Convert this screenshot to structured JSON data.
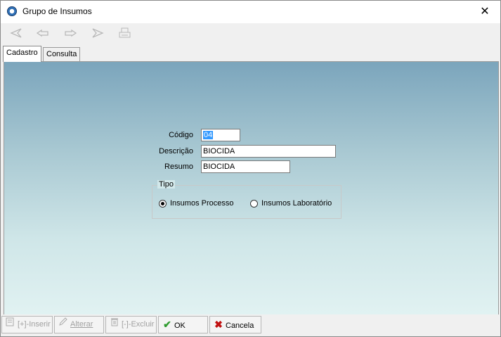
{
  "window": {
    "title": "Grupo de Insumos",
    "close_glyph": "✕"
  },
  "toolbar": {
    "icons": [
      "first-icon",
      "previous-icon",
      "next-icon",
      "last-icon",
      "print-icon"
    ]
  },
  "tabs": [
    {
      "label": "Cadastro",
      "active": true
    },
    {
      "label": "Consulta",
      "active": false
    }
  ],
  "form": {
    "codigo_label": "Código",
    "codigo_value": "04",
    "descricao_label": "Descrição",
    "descricao_value": "BIOCIDA",
    "resumo_label": "Resumo",
    "resumo_value": "BIOCIDA",
    "tipo": {
      "label": "Tipo",
      "options": [
        {
          "label": "Insumos Processo",
          "selected": true
        },
        {
          "label": "Insumos Laboratório",
          "selected": false
        }
      ]
    }
  },
  "buttons": {
    "inserir": "[+]-Inserir",
    "alterar": "Alterar",
    "excluir": "[-]-Excluir",
    "ok": "OK",
    "cancela": "Cancela"
  },
  "colors": {
    "gradient_top": "#7ba5bc",
    "gradient_bottom": "#e1f2f2",
    "ok_green": "#2e9b2e",
    "cancel_red": "#c01010",
    "selection": "#3399ff"
  }
}
